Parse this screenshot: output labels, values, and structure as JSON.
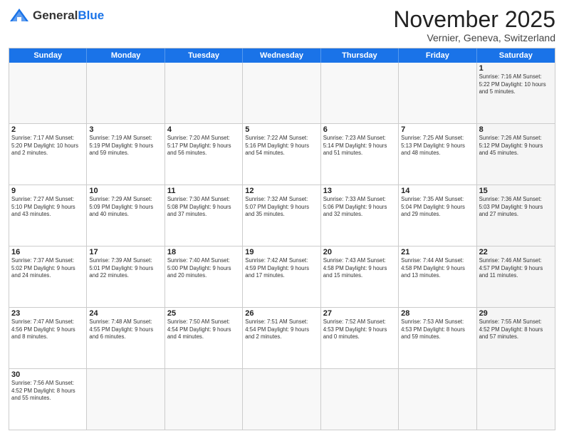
{
  "logo": {
    "text_general": "General",
    "text_blue": "Blue"
  },
  "title": "November 2025",
  "location": "Vernier, Geneva, Switzerland",
  "days_of_week": [
    "Sunday",
    "Monday",
    "Tuesday",
    "Wednesday",
    "Thursday",
    "Friday",
    "Saturday"
  ],
  "rows": [
    [
      {
        "day": "",
        "empty": true,
        "info": ""
      },
      {
        "day": "",
        "empty": true,
        "info": ""
      },
      {
        "day": "",
        "empty": true,
        "info": ""
      },
      {
        "day": "",
        "empty": true,
        "info": ""
      },
      {
        "day": "",
        "empty": true,
        "info": ""
      },
      {
        "day": "",
        "empty": true,
        "info": ""
      },
      {
        "day": "1",
        "info": "Sunrise: 7:16 AM\nSunset: 5:22 PM\nDaylight: 10 hours\nand 5 minutes."
      }
    ],
    [
      {
        "day": "2",
        "info": "Sunrise: 7:17 AM\nSunset: 5:20 PM\nDaylight: 10 hours\nand 2 minutes."
      },
      {
        "day": "3",
        "info": "Sunrise: 7:19 AM\nSunset: 5:19 PM\nDaylight: 9 hours\nand 59 minutes."
      },
      {
        "day": "4",
        "info": "Sunrise: 7:20 AM\nSunset: 5:17 PM\nDaylight: 9 hours\nand 56 minutes."
      },
      {
        "day": "5",
        "info": "Sunrise: 7:22 AM\nSunset: 5:16 PM\nDaylight: 9 hours\nand 54 minutes."
      },
      {
        "day": "6",
        "info": "Sunrise: 7:23 AM\nSunset: 5:14 PM\nDaylight: 9 hours\nand 51 minutes."
      },
      {
        "day": "7",
        "info": "Sunrise: 7:25 AM\nSunset: 5:13 PM\nDaylight: 9 hours\nand 48 minutes."
      },
      {
        "day": "8",
        "info": "Sunrise: 7:26 AM\nSunset: 5:12 PM\nDaylight: 9 hours\nand 45 minutes."
      }
    ],
    [
      {
        "day": "9",
        "info": "Sunrise: 7:27 AM\nSunset: 5:10 PM\nDaylight: 9 hours\nand 43 minutes."
      },
      {
        "day": "10",
        "info": "Sunrise: 7:29 AM\nSunset: 5:09 PM\nDaylight: 9 hours\nand 40 minutes."
      },
      {
        "day": "11",
        "info": "Sunrise: 7:30 AM\nSunset: 5:08 PM\nDaylight: 9 hours\nand 37 minutes."
      },
      {
        "day": "12",
        "info": "Sunrise: 7:32 AM\nSunset: 5:07 PM\nDaylight: 9 hours\nand 35 minutes."
      },
      {
        "day": "13",
        "info": "Sunrise: 7:33 AM\nSunset: 5:06 PM\nDaylight: 9 hours\nand 32 minutes."
      },
      {
        "day": "14",
        "info": "Sunrise: 7:35 AM\nSunset: 5:04 PM\nDaylight: 9 hours\nand 29 minutes."
      },
      {
        "day": "15",
        "info": "Sunrise: 7:36 AM\nSunset: 5:03 PM\nDaylight: 9 hours\nand 27 minutes."
      }
    ],
    [
      {
        "day": "16",
        "info": "Sunrise: 7:37 AM\nSunset: 5:02 PM\nDaylight: 9 hours\nand 24 minutes."
      },
      {
        "day": "17",
        "info": "Sunrise: 7:39 AM\nSunset: 5:01 PM\nDaylight: 9 hours\nand 22 minutes."
      },
      {
        "day": "18",
        "info": "Sunrise: 7:40 AM\nSunset: 5:00 PM\nDaylight: 9 hours\nand 20 minutes."
      },
      {
        "day": "19",
        "info": "Sunrise: 7:42 AM\nSunset: 4:59 PM\nDaylight: 9 hours\nand 17 minutes."
      },
      {
        "day": "20",
        "info": "Sunrise: 7:43 AM\nSunset: 4:58 PM\nDaylight: 9 hours\nand 15 minutes."
      },
      {
        "day": "21",
        "info": "Sunrise: 7:44 AM\nSunset: 4:58 PM\nDaylight: 9 hours\nand 13 minutes."
      },
      {
        "day": "22",
        "info": "Sunrise: 7:46 AM\nSunset: 4:57 PM\nDaylight: 9 hours\nand 11 minutes."
      }
    ],
    [
      {
        "day": "23",
        "info": "Sunrise: 7:47 AM\nSunset: 4:56 PM\nDaylight: 9 hours\nand 8 minutes."
      },
      {
        "day": "24",
        "info": "Sunrise: 7:48 AM\nSunset: 4:55 PM\nDaylight: 9 hours\nand 6 minutes."
      },
      {
        "day": "25",
        "info": "Sunrise: 7:50 AM\nSunset: 4:54 PM\nDaylight: 9 hours\nand 4 minutes."
      },
      {
        "day": "26",
        "info": "Sunrise: 7:51 AM\nSunset: 4:54 PM\nDaylight: 9 hours\nand 2 minutes."
      },
      {
        "day": "27",
        "info": "Sunrise: 7:52 AM\nSunset: 4:53 PM\nDaylight: 9 hours\nand 0 minutes."
      },
      {
        "day": "28",
        "info": "Sunrise: 7:53 AM\nSunset: 4:53 PM\nDaylight: 8 hours\nand 59 minutes."
      },
      {
        "day": "29",
        "info": "Sunrise: 7:55 AM\nSunset: 4:52 PM\nDaylight: 8 hours\nand 57 minutes."
      }
    ],
    [
      {
        "day": "30",
        "info": "Sunrise: 7:56 AM\nSunset: 4:52 PM\nDaylight: 8 hours\nand 55 minutes."
      },
      {
        "day": "",
        "empty": true,
        "info": ""
      },
      {
        "day": "",
        "empty": true,
        "info": ""
      },
      {
        "day": "",
        "empty": true,
        "info": ""
      },
      {
        "day": "",
        "empty": true,
        "info": ""
      },
      {
        "day": "",
        "empty": true,
        "info": ""
      },
      {
        "day": "",
        "empty": true,
        "info": ""
      }
    ]
  ]
}
